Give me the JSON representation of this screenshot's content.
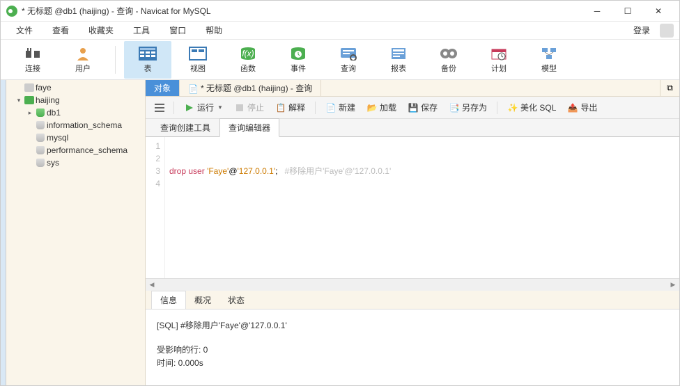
{
  "window": {
    "title": "* 无标题 @db1 (haijing) - 查询 - Navicat for MySQL"
  },
  "menu": {
    "items": [
      "文件",
      "查看",
      "收藏夹",
      "工具",
      "窗口",
      "帮助"
    ],
    "login": "登录"
  },
  "toolbar": {
    "items": [
      {
        "label": "连接",
        "icon": "plug"
      },
      {
        "label": "用户",
        "icon": "user"
      },
      {
        "label": "表",
        "icon": "table",
        "active": true
      },
      {
        "label": "视图",
        "icon": "view"
      },
      {
        "label": "函数",
        "icon": "fx"
      },
      {
        "label": "事件",
        "icon": "event"
      },
      {
        "label": "查询",
        "icon": "query"
      },
      {
        "label": "报表",
        "icon": "report"
      },
      {
        "label": "备份",
        "icon": "backup"
      },
      {
        "label": "计划",
        "icon": "schedule"
      },
      {
        "label": "模型",
        "icon": "model"
      }
    ]
  },
  "sidebar": {
    "items": [
      {
        "label": "faye",
        "depth": 0,
        "chev": "",
        "icon": "conn"
      },
      {
        "label": "haijing",
        "depth": 0,
        "chev": "▾",
        "icon": "conn-green"
      },
      {
        "label": "db1",
        "depth": 1,
        "chev": "▸",
        "icon": "db-green"
      },
      {
        "label": "information_schema",
        "depth": 1,
        "chev": "",
        "icon": "db-grey"
      },
      {
        "label": "mysql",
        "depth": 1,
        "chev": "",
        "icon": "db-grey"
      },
      {
        "label": "performance_schema",
        "depth": 1,
        "chev": "",
        "icon": "db-grey"
      },
      {
        "label": "sys",
        "depth": 1,
        "chev": "",
        "icon": "db-grey"
      }
    ]
  },
  "docTabs": {
    "items": [
      {
        "label": "对象",
        "active": true
      },
      {
        "label": "* 无标题 @db1 (haijing) - 查询",
        "active": false
      }
    ]
  },
  "actions": {
    "run": "运行",
    "stop": "停止",
    "explain": "解释",
    "new": "新建",
    "load": "加载",
    "save": "保存",
    "saveas": "另存为",
    "beautify": "美化 SQL",
    "export": "导出"
  },
  "subTabs": {
    "items": [
      "查询创建工具",
      "查询编辑器"
    ],
    "active": 1
  },
  "editor": {
    "lines": [
      {
        "n": 1,
        "html": ""
      },
      {
        "n": 2,
        "html": ""
      },
      {
        "n": 3,
        "html": "<span class='kw'>drop</span> <span class='kw'>user</span> <span class='str'>'Faye'</span>@<span class='str'>'127.0.0.1'</span>;   <span class='cmt'>#移除用户'Faye'@'127.0.0.1'</span>"
      },
      {
        "n": 4,
        "html": ""
      }
    ]
  },
  "resultTabs": {
    "items": [
      "信息",
      "概况",
      "状态"
    ],
    "active": 0
  },
  "result": {
    "lines": [
      "[SQL]  #移除用户'Faye'@'127.0.0.1'",
      "",
      "受影响的行: 0",
      "时间: 0.000s"
    ]
  }
}
